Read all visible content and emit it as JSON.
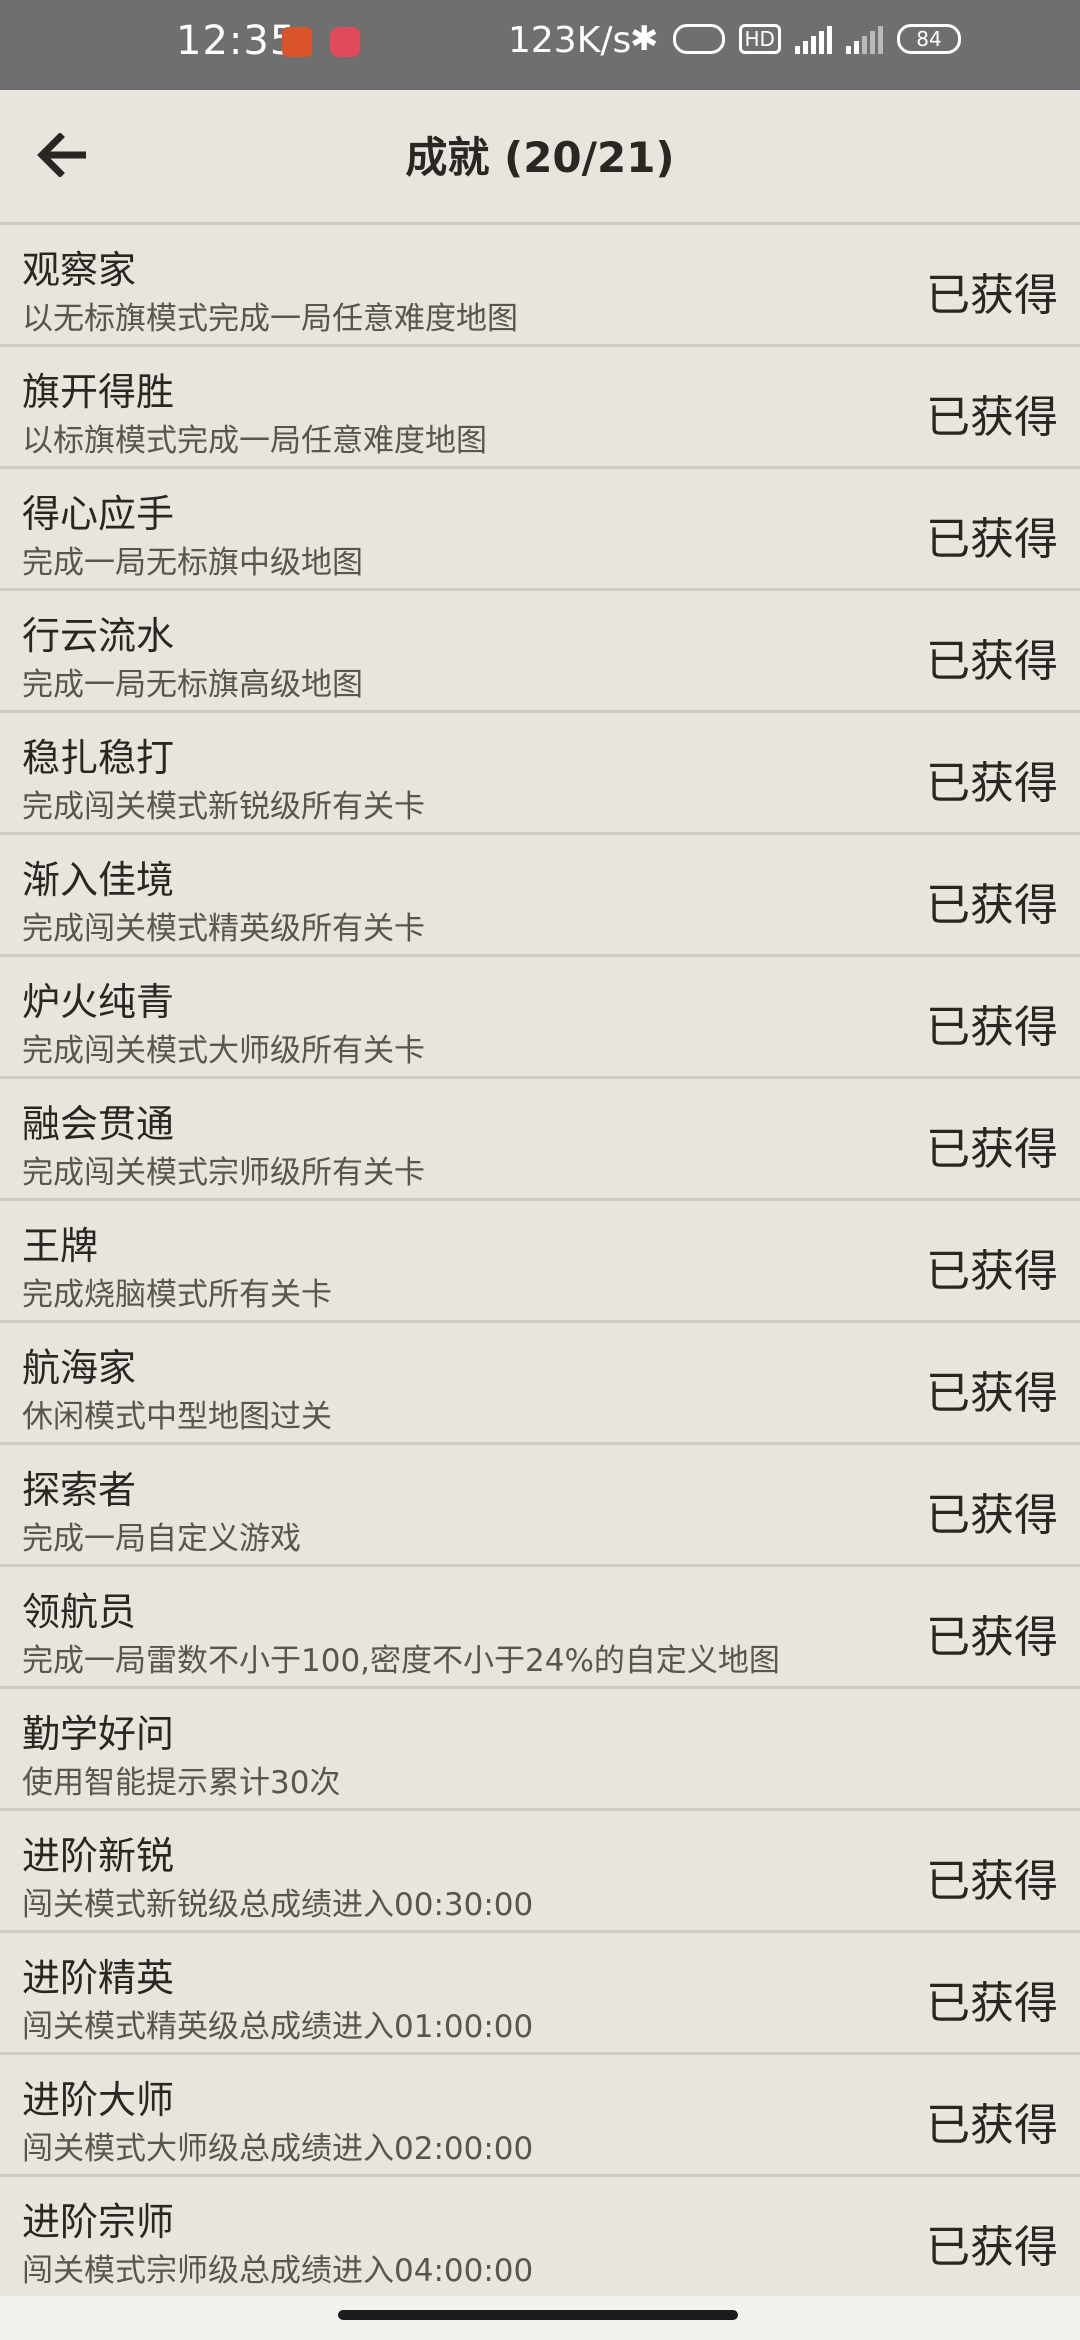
{
  "status_bar": {
    "time": "12:35",
    "net_speed": "123K/s",
    "hd_label": "HD",
    "battery": "84",
    "icons": [
      "notification-app-icon",
      "notification-app2-icon",
      "bluetooth-icon",
      "vibrate-icon",
      "hd-icon",
      "signal-5g-icon",
      "signal-4g-icon",
      "battery-icon"
    ]
  },
  "header": {
    "title": "成就 (20/21)",
    "back_icon": "arrow-left-icon"
  },
  "achievements": [
    {
      "title": "观察家",
      "desc": "以无标旗模式完成一局任意难度地图",
      "status": "已获得"
    },
    {
      "title": "旗开得胜",
      "desc": "以标旗模式完成一局任意难度地图",
      "status": "已获得"
    },
    {
      "title": "得心应手",
      "desc": "完成一局无标旗中级地图",
      "status": "已获得"
    },
    {
      "title": "行云流水",
      "desc": "完成一局无标旗高级地图",
      "status": "已获得"
    },
    {
      "title": "稳扎稳打",
      "desc": "完成闯关模式新锐级所有关卡",
      "status": "已获得"
    },
    {
      "title": "渐入佳境",
      "desc": "完成闯关模式精英级所有关卡",
      "status": "已获得"
    },
    {
      "title": "炉火纯青",
      "desc": "完成闯关模式大师级所有关卡",
      "status": "已获得"
    },
    {
      "title": "融会贯通",
      "desc": "完成闯关模式宗师级所有关卡",
      "status": "已获得"
    },
    {
      "title": "王牌",
      "desc": "完成烧脑模式所有关卡",
      "status": "已获得"
    },
    {
      "title": "航海家",
      "desc": "休闲模式中型地图过关",
      "status": "已获得"
    },
    {
      "title": "探索者",
      "desc": "完成一局自定义游戏",
      "status": "已获得"
    },
    {
      "title": "领航员",
      "desc": "完成一局雷数不小于100,密度不小于24%的自定义地图",
      "status": "已获得"
    },
    {
      "title": "勤学好问",
      "desc": "使用智能提示累计30次",
      "status": ""
    },
    {
      "title": "进阶新锐",
      "desc": "闯关模式新锐级总成绩进入00:30:00",
      "status": "已获得"
    },
    {
      "title": "进阶精英",
      "desc": "闯关模式精英级总成绩进入01:00:00",
      "status": "已获得"
    },
    {
      "title": "进阶大师",
      "desc": "闯关模式大师级总成绩进入02:00:00",
      "status": "已获得"
    },
    {
      "title": "进阶宗师",
      "desc": "闯关模式宗师级总成绩进入04:00:00",
      "status": "已获得"
    }
  ],
  "colors": {
    "background": "#e9e5de",
    "status_bar": "#6f6f6f",
    "divider": "#cfcac3",
    "text_primary": "#2a2622",
    "text_secondary": "#5a554f"
  }
}
